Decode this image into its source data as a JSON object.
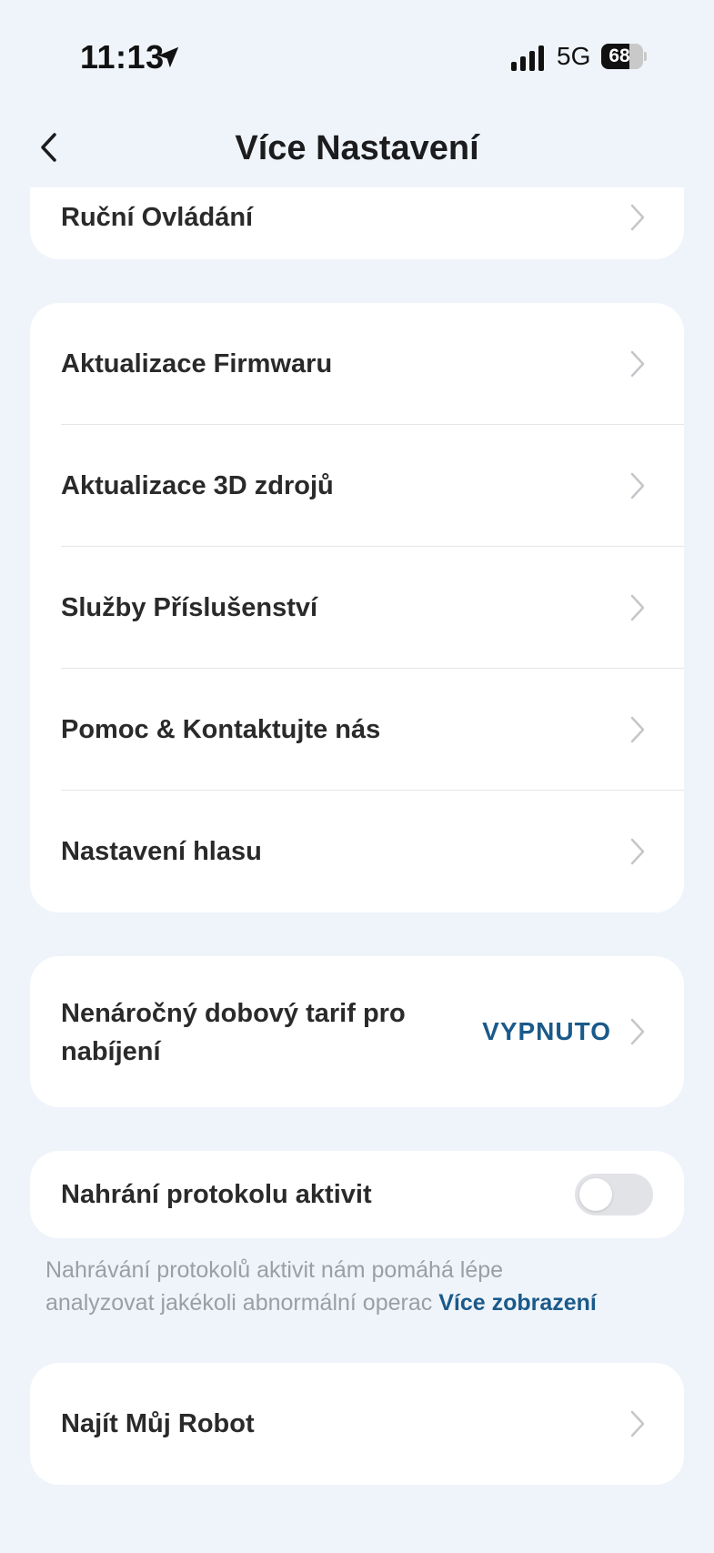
{
  "status_bar": {
    "time": "11:13",
    "network": "5G",
    "battery": "68",
    "battery_level": 0.68,
    "location_icon": "location-arrow-icon",
    "signal_icon": "cellular-signal-icon"
  },
  "header": {
    "title": "Více Nastavení",
    "back_icon": "chevron-left-icon"
  },
  "cards": {
    "manual_control": {
      "label": "Ruční Ovládání"
    },
    "main": {
      "items": [
        {
          "label": "Aktualizace Firmwaru"
        },
        {
          "label": "Aktualizace 3D zdrojů"
        },
        {
          "label": "Služby Příslušenství"
        },
        {
          "label": "Pomoc & Kontaktujte nás"
        },
        {
          "label": "Nastavení hlasu"
        }
      ]
    },
    "offpeak": {
      "label_line1": "Nenáročný dobový tarif pro",
      "label_line2": "nabíjení",
      "value": "VYPNUTO"
    },
    "activity_log": {
      "label": "Nahrání protokolu aktivit",
      "toggle_on": false
    },
    "find_robot": {
      "label": "Najít Můj Robot"
    }
  },
  "info": {
    "line1": "Nahrávání protokolů aktivit nám pomáhá lépe",
    "line2": "analyzovat jakékoli abnormální operac",
    "more_link": "Více zobrazení"
  },
  "colors": {
    "background": "#eff4fa",
    "card": "#ffffff",
    "accent": "#1a5a8a",
    "muted_text": "#9a9ea5"
  }
}
